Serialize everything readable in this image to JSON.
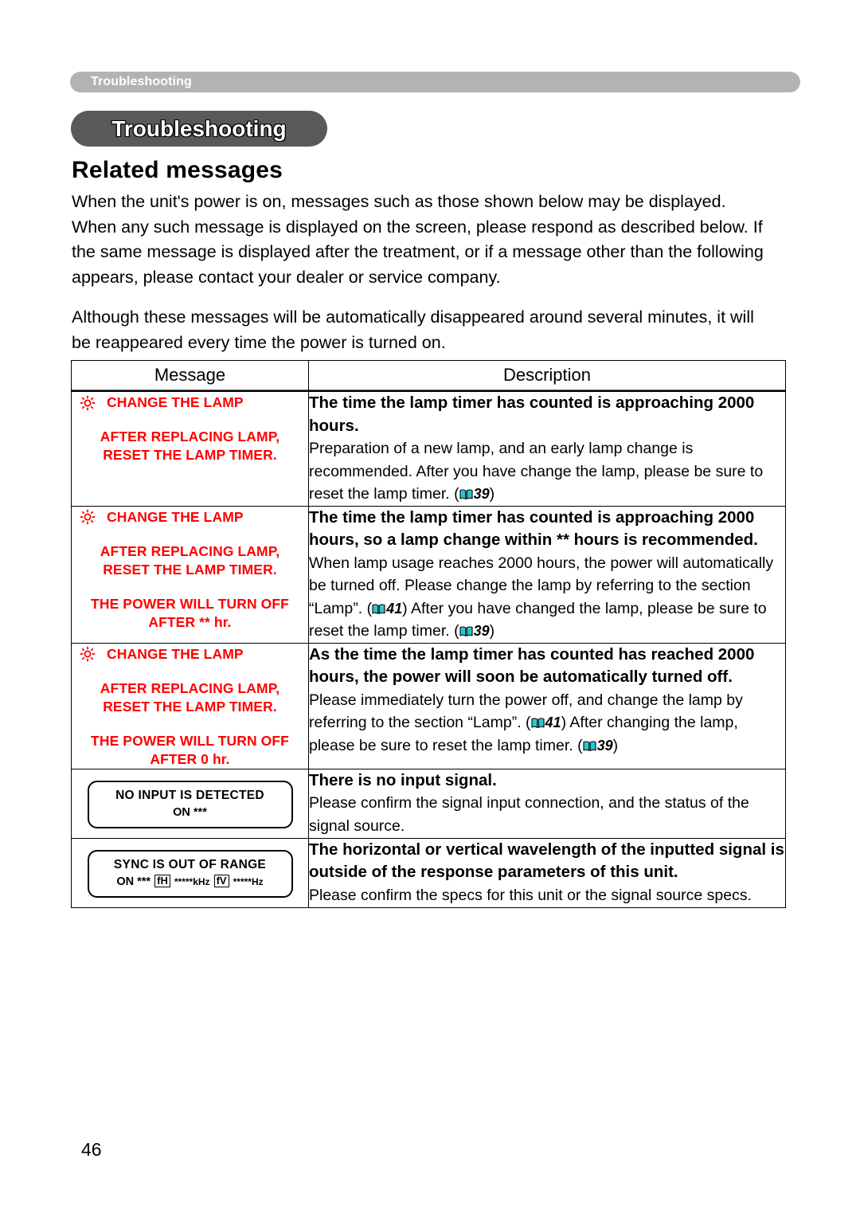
{
  "running_header": {
    "label": "Troubleshooting"
  },
  "chapter": {
    "title": "Troubleshooting"
  },
  "section": {
    "heading": "Related messages"
  },
  "intro": {
    "paragraph_1": "When the unit's power is on, messages such as those shown below may be displayed. When any such message is displayed on the screen, please respond as described below. If the same message is displayed after the treatment, or if a message other than the following appears, please contact your dealer or service company.",
    "paragraph_2": "Although these messages will be automatically disappeared around several minutes, it will be reappeared every time the power is turned on."
  },
  "table": {
    "headers": {
      "message": "Message",
      "description": "Description"
    },
    "rows": [
      {
        "message": {
          "icon": "sun-icon",
          "blocks": [
            [
              "CHANGE THE LAMP"
            ],
            [
              "AFTER REPLACING LAMP,",
              "RESET THE LAMP TIMER."
            ]
          ]
        },
        "description": {
          "bold": "The time the lamp timer has counted is approaching 2000 hours.",
          "body_1": "Preparation of a new lamp, and an early lamp change is recommended. After you have change the lamp, please be sure to reset the lamp timer. (",
          "ref_1": "39",
          "body_2": ")"
        }
      },
      {
        "message": {
          "icon": "sun-icon",
          "blocks": [
            [
              "CHANGE THE LAMP"
            ],
            [
              "AFTER REPLACING LAMP,",
              "RESET THE LAMP TIMER."
            ],
            [
              "THE POWER WILL TURN OFF",
              "AFTER ** hr."
            ]
          ]
        },
        "description": {
          "bold": "The time the lamp timer has counted is approaching 2000 hours, so a lamp change within ** hours is recommended.",
          "body_1": "When lamp usage reaches 2000 hours, the power will automatically be turned off. Please change the lamp by referring to the section “Lamp”. (",
          "ref_1": "41",
          "body_2": ")  After you have changed the lamp, please be sure to reset the lamp timer. (",
          "ref_2": "39",
          "body_3": ")"
        }
      },
      {
        "message": {
          "icon": "sun-icon",
          "blocks": [
            [
              "CHANGE THE LAMP"
            ],
            [
              "AFTER REPLACING LAMP,",
              "RESET THE LAMP TIMER."
            ],
            [
              "THE POWER WILL TURN OFF",
              "AFTER 0 hr."
            ]
          ]
        },
        "description": {
          "bold": "As the time the lamp timer has counted has reached 2000 hours, the power will soon be automatically turned off.",
          "body_1": "Please immediately turn the power off, and change the lamp by referring to the section “Lamp”. (",
          "ref_1": "41",
          "body_2": ")  After changing the lamp, please be sure to reset the lamp timer. (",
          "ref_2": "39",
          "body_3": ")"
        }
      },
      {
        "message": {
          "box": {
            "line_1": "NO INPUT IS DETECTED",
            "line_2_prefix": "ON ***"
          }
        },
        "description": {
          "bold": "There is no input signal.",
          "body_1": "Please confirm the signal input connection, and the status of the signal source."
        }
      },
      {
        "message": {
          "box": {
            "line_1": "SYNC IS OUT OF RANGE",
            "line_2_on": "ON ***",
            "token_h": "fH",
            "line_2_khz": "*****kHz",
            "token_v": "fV",
            "line_2_hz": "*****Hz"
          }
        },
        "description": {
          "bold": "The horizontal or vertical wavelength of the inputted signal is outside of the response parameters of this unit.",
          "body_1": "Please confirm the specs for this unit or the signal source specs."
        }
      }
    ]
  },
  "folio": {
    "page_number": "46"
  },
  "colors": {
    "osd_red": "#ff0000",
    "book_icon_cyan": "#29c8cd",
    "running_header_gray": "#b3b3b3",
    "chapter_pill_gray": "#595959"
  }
}
